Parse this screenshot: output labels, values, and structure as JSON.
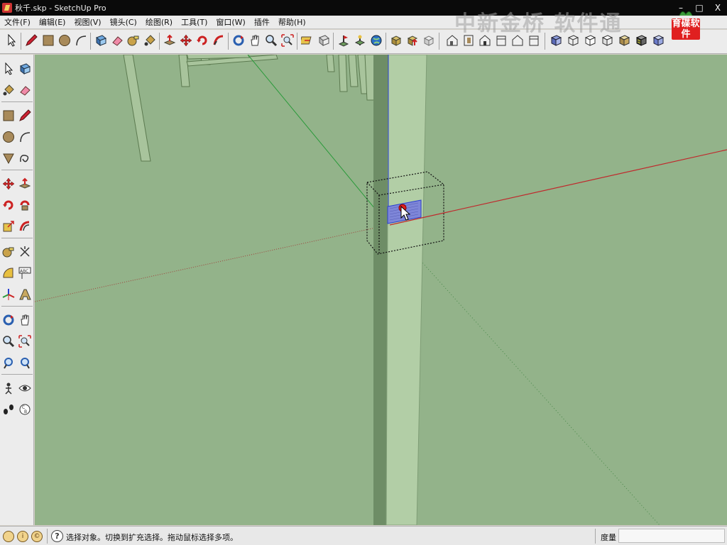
{
  "window": {
    "title": "秋千.skp - SketchUp Pro",
    "minimize": "–",
    "maximize": "□",
    "close": "X"
  },
  "menu": {
    "items": [
      "文件(F)",
      "编辑(E)",
      "视图(V)",
      "镜头(C)",
      "绘图(R)",
      "工具(T)",
      "窗口(W)",
      "插件",
      "帮助(H)"
    ]
  },
  "watermark": {
    "text": "中新金桥 软件通",
    "brand": "育碟软件"
  },
  "statusbar": {
    "message": "选择对象。切换到扩充选择。拖动鼠标选择多项。",
    "measure_label": "度量",
    "measure_value": ""
  },
  "colors": {
    "viewport_bg": "#93b38a",
    "axis_red": "#c0282c",
    "axis_green": "#2a9a3a",
    "axis_blue": "#2a3fd0",
    "selection_fill": "#7e86d8",
    "brand_red": "#e02020"
  },
  "icons": {
    "top_toolbar": [
      "select-arrow-icon",
      "pencil-icon",
      "rectangle-icon",
      "circle-icon",
      "arc-icon",
      "make-component-icon",
      "eraser-icon",
      "tape-measure-icon",
      "paint-bucket-icon",
      "push-pull-icon",
      "move-icon",
      "rotate-icon",
      "follow-me-icon",
      "orbit-icon",
      "pan-icon",
      "zoom-icon",
      "zoom-extents-icon",
      "section-plane-icon",
      "section-display-icon",
      "add-location-icon",
      "photo-texture-icon",
      "google-earth-icon",
      "get-models-icon",
      "share-model-icon",
      "share-component-icon",
      "iso-view-icon",
      "top-view-icon",
      "front-view-icon",
      "right-view-icon",
      "back-view-icon",
      "left-view-icon",
      "xray-style-icon",
      "wireframe-style-icon",
      "hidden-line-style-icon",
      "shaded-style-icon",
      "shaded-texture-style-icon",
      "monochrome-style-icon"
    ],
    "left_toolbar": [
      "select-arrow-icon",
      "make-component-icon",
      "paint-bucket-icon",
      "eraser-icon",
      "rectangle-icon",
      "pencil-icon",
      "circle-icon",
      "arc-icon",
      "polygon-icon",
      "freehand-icon",
      "move-icon",
      "push-pull-icon",
      "rotate-icon",
      "follow-me-icon",
      "scale-icon",
      "offset-icon",
      "tape-measure-icon",
      "dimension-icon",
      "protractor-icon",
      "text-label-icon",
      "axes-icon",
      "3d-text-icon",
      "orbit-icon",
      "pan-icon",
      "zoom-icon",
      "zoom-window-icon",
      "previous-view-icon",
      "next-view-icon",
      "position-camera-icon",
      "look-around-icon",
      "walk-icon",
      "section-plane-icon"
    ]
  }
}
